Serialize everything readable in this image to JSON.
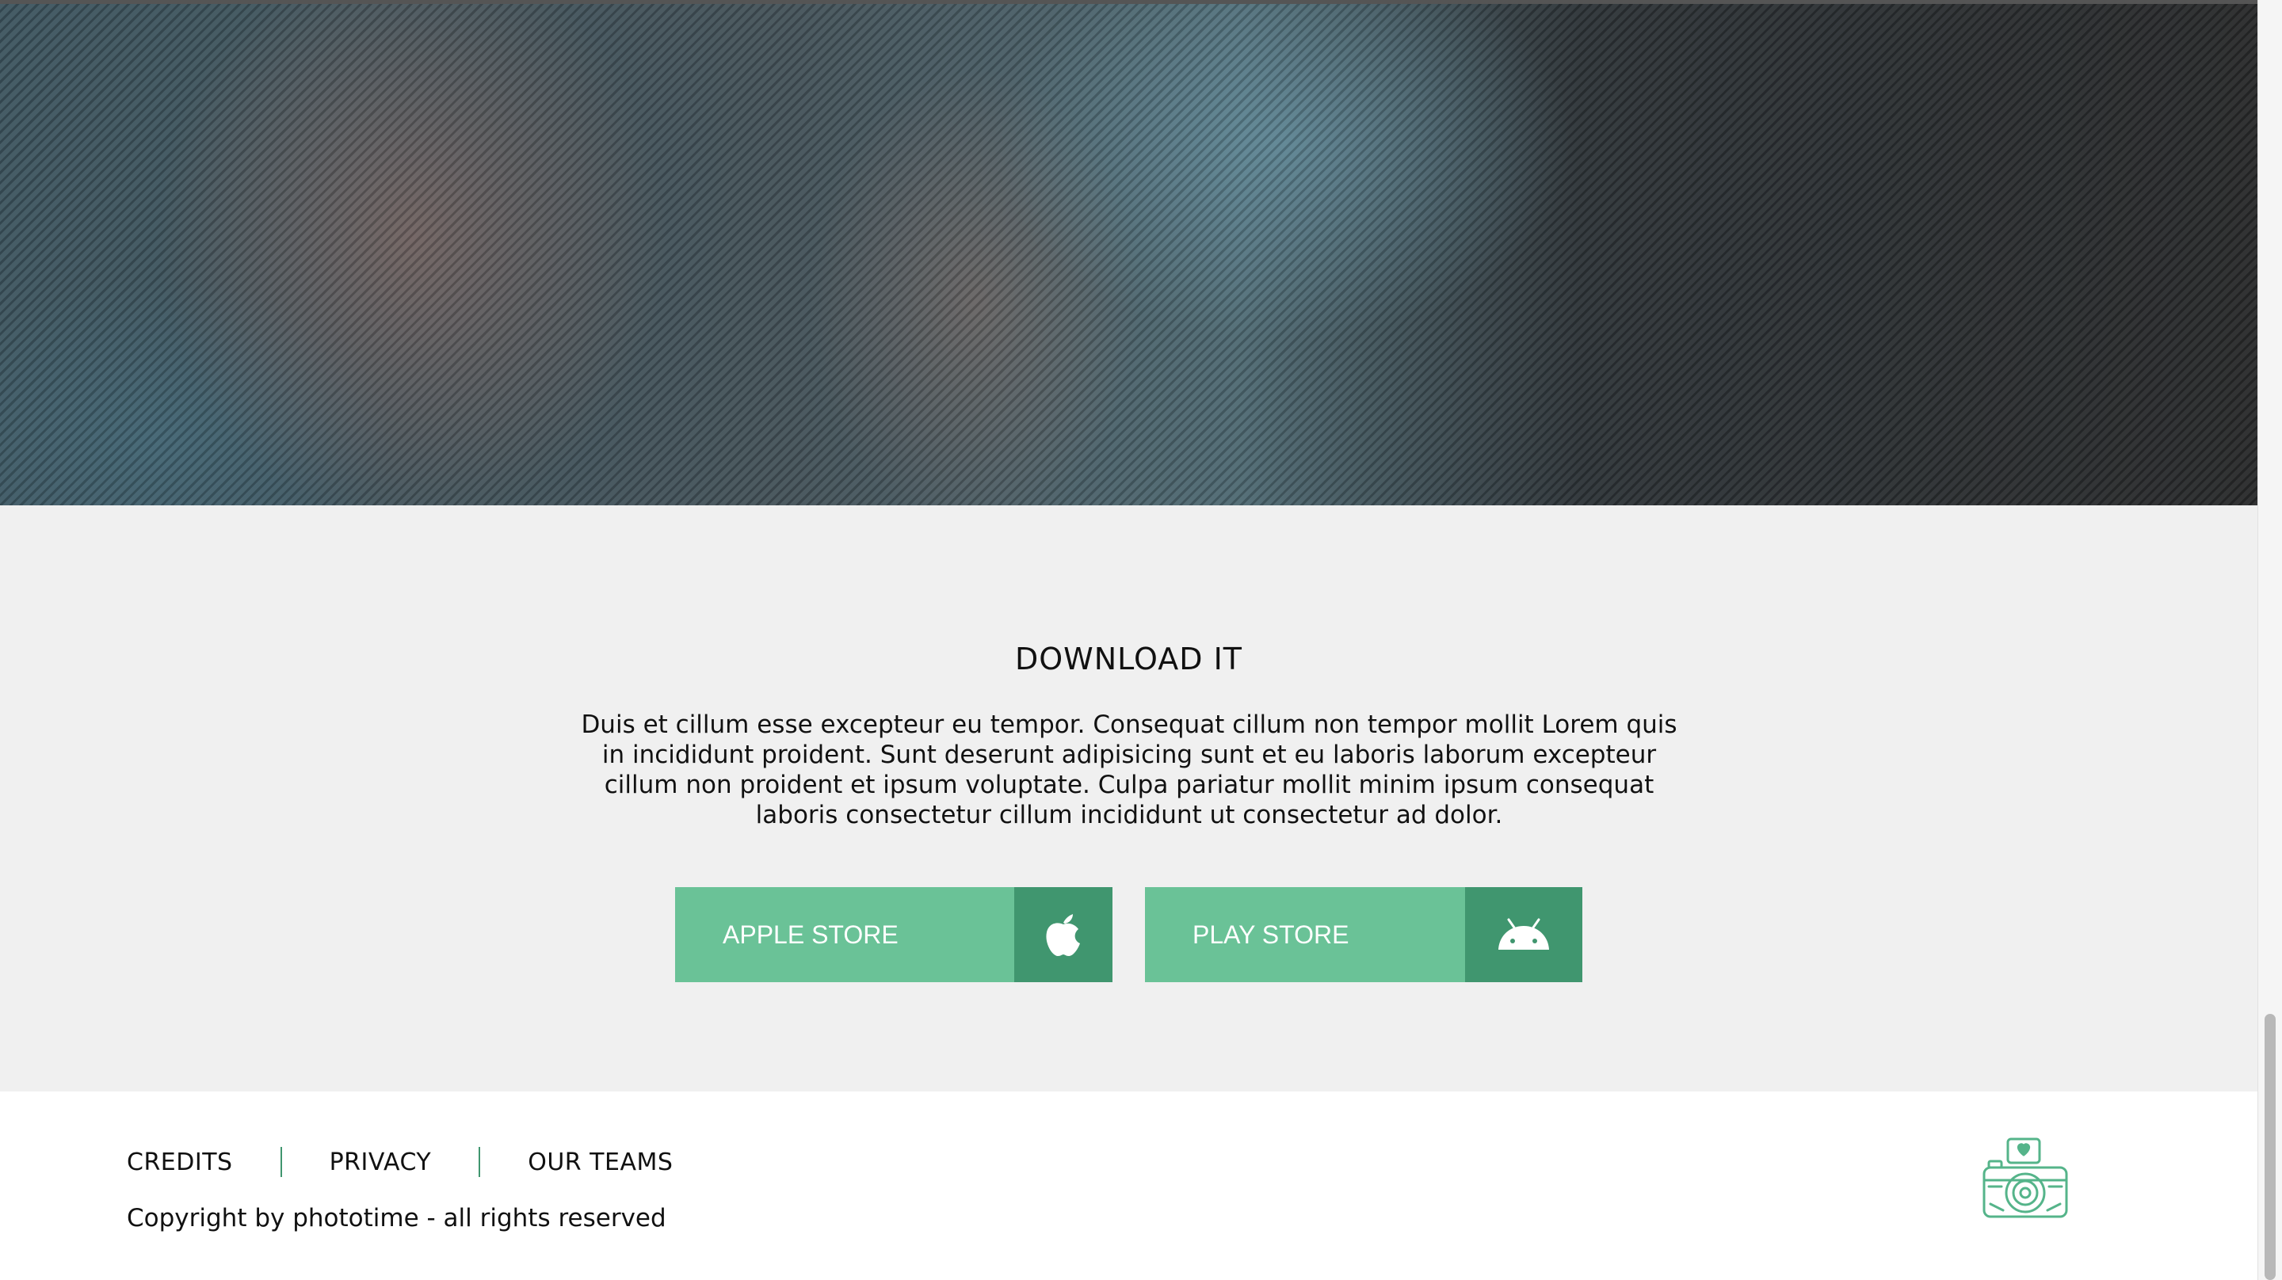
{
  "download": {
    "title": "DOWNLOAD IT",
    "description": "Duis et cillum esse excepteur eu tempor. Consequat cillum non tempor mollit Lorem quis in incididunt proident. Sunt deserunt adipisicing sunt et eu laboris laborum excepteur cillum non proident et ipsum voluptate. Culpa pariatur mollit minim ipsum consequat laboris consectetur cillum incididunt ut consectetur ad dolor.",
    "buttons": [
      {
        "label": "APPLE STORE",
        "icon": "apple-icon"
      },
      {
        "label": "PLAY STORE",
        "icon": "android-icon"
      }
    ]
  },
  "footer": {
    "links": [
      "CREDITS",
      "PRIVACY",
      "OUR TEAMS"
    ],
    "copyright": "Copyright by phototime - all rights reserved",
    "logo_icon": "camera-heart-icon"
  },
  "colors": {
    "accent": "#6ac297",
    "accent_dark": "#40966f",
    "section_bg": "#f0f0f0",
    "footer_bg": "#ffffff"
  }
}
